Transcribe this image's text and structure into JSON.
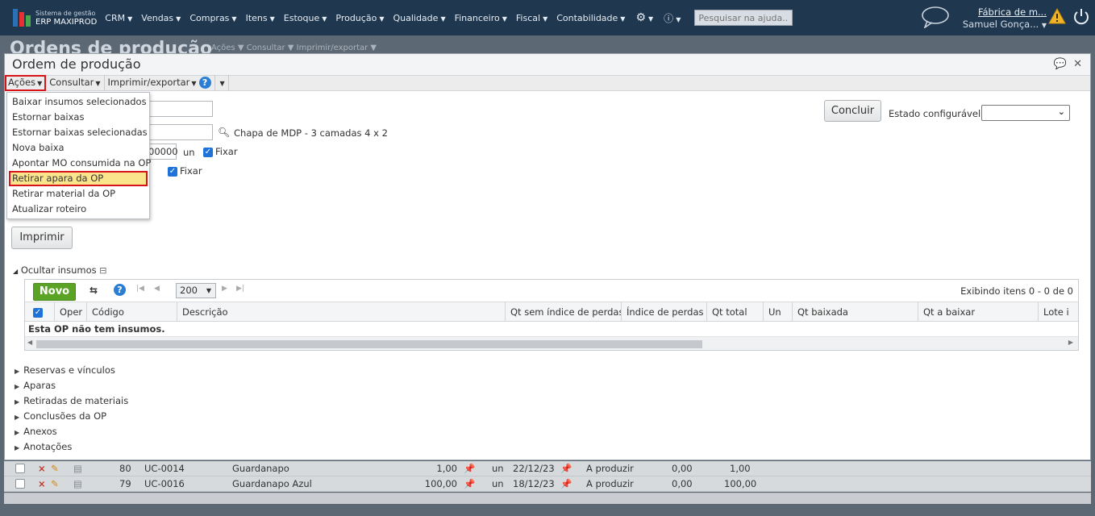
{
  "topbar": {
    "logo_line1": "Sistema de gestão",
    "logo_line2": "ERP MAXIPROD",
    "nav_items": [
      "CRM",
      "Vendas",
      "Compras",
      "Itens",
      "Estoque",
      "Produção",
      "Qualidade",
      "Financeiro",
      "Fiscal",
      "Contabilidade"
    ],
    "search_placeholder": "Pesquisar na ajuda...",
    "company": "Fábrica de m...",
    "user": "Samuel Gonça..."
  },
  "background": {
    "title": "Ordens de produção",
    "actions": "Ações ▼  Consultar ▼  Imprimir/exportar ▼",
    "rows": [
      {
        "num": "80",
        "code": "UC-0014",
        "desc": "Guardanapo",
        "qty": "1,00",
        "un": "un",
        "date": "22/12/23",
        "status": "A produzir",
        "v1": "0,00",
        "v2": "1,00"
      },
      {
        "num": "79",
        "code": "UC-0016",
        "desc": "Guardanapo Azul",
        "qty": "100,00",
        "un": "un",
        "date": "18/12/23",
        "status": "A produzir",
        "v1": "0,00",
        "v2": "100,00"
      }
    ]
  },
  "modal": {
    "title": "Ordem de produção",
    "toolbar": {
      "acoes": "Ações",
      "consultar": "Consultar",
      "imprimir": "Imprimir/exportar"
    },
    "menu": [
      "Baixar insumos selecionados",
      "Estornar baixas",
      "Estornar baixas selecionadas",
      "Nova baixa",
      "Apontar MO consumida na OP",
      "Retirar apara da OP",
      "Retirar material da OP",
      "Atualizar roteiro"
    ],
    "item_desc": "Chapa de MDP - 3 camadas 4 x 2",
    "qty_value": "00000",
    "unit": "un",
    "fixar": "Fixar",
    "concluir": "Concluir",
    "estado_label": "Estado configurável",
    "imprimir_btn": "Imprimir",
    "insumos_toggle": "Ocultar insumos",
    "grid": {
      "novo": "Novo",
      "page_size": "200",
      "exibindo": "Exibindo itens 0 - 0 de 0",
      "columns": [
        "Oper",
        "Código",
        "Descrição",
        "Qt sem índice de perdas",
        "Índice de perdas",
        "Qt total",
        "Un",
        "Qt baixada",
        "Qt a baixar",
        "Lote i"
      ],
      "empty": "Esta OP não tem insumos."
    },
    "sections": [
      "Reservas e vínculos",
      "Aparas",
      "Retiradas de materiais",
      "Conclusões da OP",
      "Anexos",
      "Anotações"
    ]
  }
}
